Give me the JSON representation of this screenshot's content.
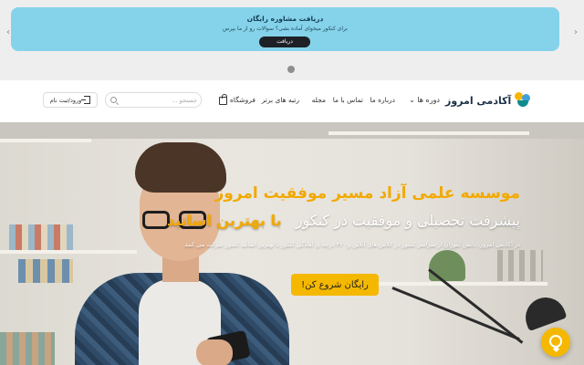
{
  "promo": {
    "title": "دریافت مشاوره رایگان",
    "subtitle": "برای کنکور میخوای آماده بشی؟ سوالات رو از ما بپرس",
    "button": "دریافت",
    "color": "#85d3ea"
  },
  "header": {
    "logo_text": "آکادمی امروز",
    "nav": {
      "courses": "دوره ها ⌄",
      "about": "درباره ما",
      "contact": "تماس با ما",
      "magazine": "مجله",
      "top_ranks": "رتبه های برتر",
      "shop": "فروشگاه"
    },
    "search_placeholder": "جستجو ...",
    "login": "ورود/ثبت نام"
  },
  "hero": {
    "title": "موسسه علمی آزاد مسیر موفقیت امروز",
    "subtitle": "پیشرفت تحصیلی و موفقیت در کنکور",
    "subtitle_accent": "با بهترین اساتید",
    "description": "در آکادمی امروز، دانش آموزان از سراسر کشور در کلاس های آنلاین و ۳۶۰ درجه ی آمادگی کنکور با بهترین اساتید کشور شرکت می کنند.",
    "cta": "رایگان شروع کن!",
    "accent_color": "#f5b800"
  },
  "icons": [
    "chevron-left-icon",
    "chevron-right-icon",
    "shopping-bag-icon",
    "search-icon",
    "login-icon",
    "chat-icon"
  ]
}
